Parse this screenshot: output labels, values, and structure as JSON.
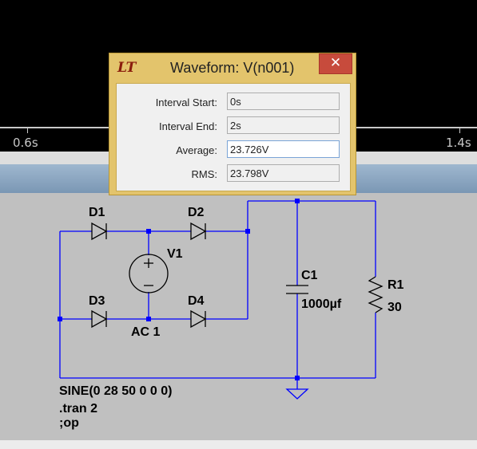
{
  "waveform": {
    "ticks": [
      {
        "label": "0.6s"
      },
      {
        "label": "1.4s"
      }
    ]
  },
  "schematic": {
    "components": {
      "d1": "D1",
      "d2": "D2",
      "d3": "D3",
      "d4": "D4",
      "v1": "V1",
      "v1_value": "AC 1",
      "c1": "C1",
      "c1_value": "1000µf",
      "r1": "R1",
      "r1_value": "30"
    },
    "directives": {
      "line1": "SINE(0 28 50 0 0 0)",
      "line2": ".tran 2",
      "line3": ";op"
    }
  },
  "dialog": {
    "logo": "LT",
    "title": "Waveform: V(n001)",
    "close_glyph": "✕",
    "fields": [
      {
        "label": "Interval Start:",
        "value": "0s"
      },
      {
        "label": "Interval End:",
        "value": "2s"
      },
      {
        "label": "Average:",
        "value": "23.726V"
      },
      {
        "label": "RMS:",
        "value": "23.798V"
      }
    ]
  },
  "colors": {
    "wire": "#0000ff",
    "dialog_frame": "#e3c46c",
    "close_button": "#c74b3c",
    "schematic_bg": "#c0c0c0"
  }
}
